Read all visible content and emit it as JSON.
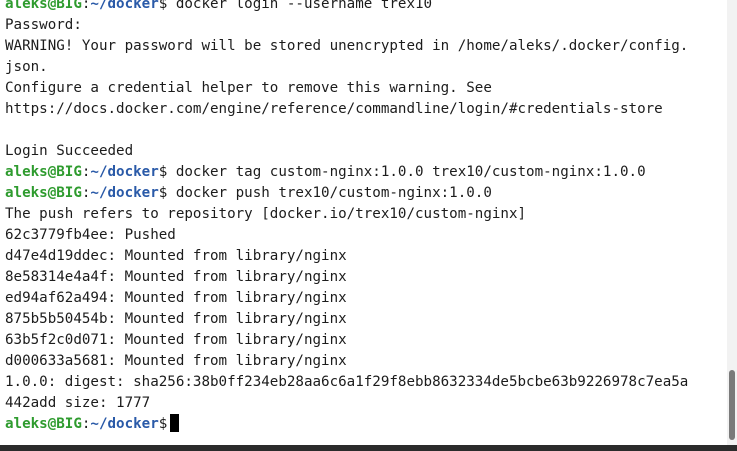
{
  "prompt": {
    "user_host": "aleks@BIG",
    "separator": ":",
    "path": "~/docker",
    "symbol": "$"
  },
  "lines": [
    {
      "type": "prompt",
      "command": " docker login --username trex10"
    },
    {
      "type": "output",
      "text": "Password:"
    },
    {
      "type": "output",
      "text": "WARNING! Your password will be stored unencrypted in /home/aleks/.docker/config."
    },
    {
      "type": "output",
      "text": "json."
    },
    {
      "type": "output",
      "text": "Configure a credential helper to remove this warning. See"
    },
    {
      "type": "output",
      "text": "https://docs.docker.com/engine/reference/commandline/login/#credentials-store"
    },
    {
      "type": "output",
      "text": ""
    },
    {
      "type": "output",
      "text": "Login Succeeded"
    },
    {
      "type": "prompt",
      "command": " docker tag custom-nginx:1.0.0 trex10/custom-nginx:1.0.0"
    },
    {
      "type": "prompt",
      "command": " docker push trex10/custom-nginx:1.0.0"
    },
    {
      "type": "output",
      "text": "The push refers to repository [docker.io/trex10/custom-nginx]"
    },
    {
      "type": "output",
      "text": "62c3779fb4ee: Pushed"
    },
    {
      "type": "output",
      "text": "d47e4d19ddec: Mounted from library/nginx"
    },
    {
      "type": "output",
      "text": "8e58314e4a4f: Mounted from library/nginx"
    },
    {
      "type": "output",
      "text": "ed94af62a494: Mounted from library/nginx"
    },
    {
      "type": "output",
      "text": "875b5b50454b: Mounted from library/nginx"
    },
    {
      "type": "output",
      "text": "63b5f2c0d071: Mounted from library/nginx"
    },
    {
      "type": "output",
      "text": "d000633a5681: Mounted from library/nginx"
    },
    {
      "type": "output",
      "text": "1.0.0: digest: sha256:38b0ff234eb28aa6c6a1f29f8ebb8632334de5bcbe63b9226978c7ea5a"
    },
    {
      "type": "output",
      "text": "442add size: 1777"
    },
    {
      "type": "prompt",
      "command": " ",
      "cursor": true
    }
  ]
}
